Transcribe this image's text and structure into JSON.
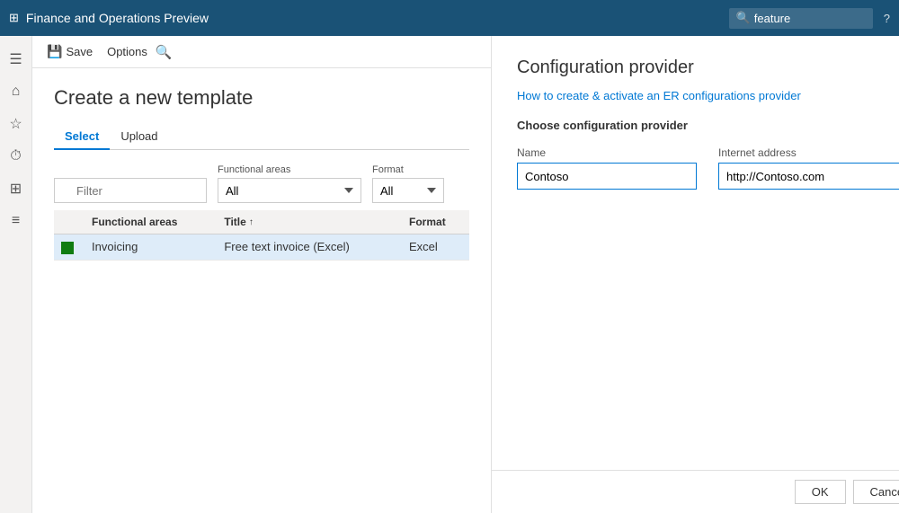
{
  "app": {
    "title": "Finance and Operations Preview",
    "search_placeholder": "feature",
    "help_tooltip": "Help"
  },
  "toolbar": {
    "save_label": "Save",
    "options_label": "Options"
  },
  "page": {
    "title": "Create a new template"
  },
  "tabs": [
    {
      "id": "select",
      "label": "Select",
      "active": true
    },
    {
      "id": "upload",
      "label": "Upload",
      "active": false
    }
  ],
  "filter": {
    "search_placeholder": "Filter",
    "functional_areas_label": "Functional areas",
    "functional_areas_value": "All",
    "format_label": "Format",
    "format_value": "All"
  },
  "table": {
    "columns": [
      {
        "key": "functional_areas",
        "label": "Functional areas"
      },
      {
        "key": "title",
        "label": "Title",
        "sort": "asc"
      },
      {
        "key": "format",
        "label": "Format"
      }
    ],
    "rows": [
      {
        "icon": true,
        "functional_areas": "Invoicing",
        "title": "Free text invoice (Excel)",
        "format": "Excel",
        "selected": true
      }
    ]
  },
  "config_panel": {
    "title": "Configuration provider",
    "link_text": "How to create & activate an ER configurations provider",
    "subtitle": "Choose configuration provider",
    "name_label": "Name",
    "name_value": "Contoso",
    "internet_address_label": "Internet address",
    "internet_address_value": "http://Contoso.com"
  },
  "footer": {
    "ok_label": "OK",
    "cancel_label": "Cancel"
  },
  "sidebar": {
    "items": [
      {
        "id": "hamburger",
        "icon": "☰"
      },
      {
        "id": "home",
        "icon": "⌂"
      },
      {
        "id": "favorite",
        "icon": "☆"
      },
      {
        "id": "recent",
        "icon": "🕐"
      },
      {
        "id": "workspace",
        "icon": "▦"
      },
      {
        "id": "list",
        "icon": "≡"
      }
    ]
  }
}
